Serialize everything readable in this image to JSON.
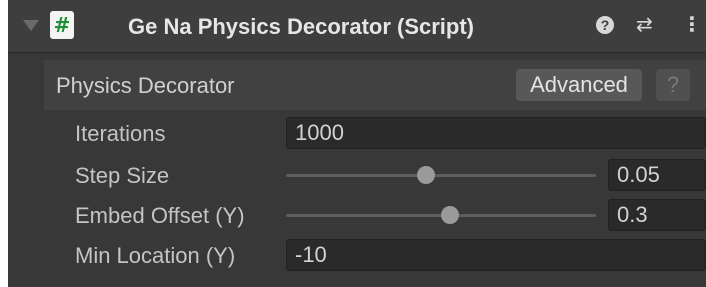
{
  "header": {
    "title": "Ge Na Physics Decorator (Script)",
    "script_icon": "#",
    "icons": [
      "foldout-arrow-icon",
      "script-icon",
      "help-icon",
      "presets-icon",
      "menu-icon"
    ],
    "help_glyph": "?",
    "presets_glyph": "⇄",
    "menu_glyph": "⋮"
  },
  "section": {
    "title": "Physics Decorator",
    "advanced_label": "Advanced",
    "help_label": "?"
  },
  "fields": {
    "iterations": {
      "label": "Iterations",
      "value": "1000"
    },
    "step_size": {
      "label": "Step Size",
      "value": "0.05",
      "slider_fraction": 0.45
    },
    "embed_offset": {
      "label": "Embed Offset (Y)",
      "value": "0.3",
      "slider_fraction": 0.53
    },
    "min_location": {
      "label": "Min Location (Y)",
      "value": "-10"
    }
  },
  "colors": {
    "panel": "#383838",
    "header": "#3e3e3e",
    "text": "#c4c4c4",
    "field": "#2a2a2a"
  }
}
